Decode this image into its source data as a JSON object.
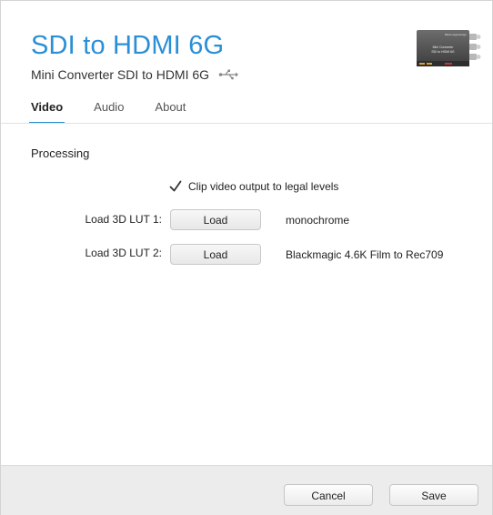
{
  "header": {
    "title": "SDI to HDMI 6G",
    "subtitle": "Mini Converter SDI to HDMI 6G",
    "device_brand": "Blackmagicdesign",
    "device_label_line1": "Mini Converter",
    "device_label_line2": "SDI to HDMI 6G",
    "usb_icon": "usb-icon"
  },
  "tabs": [
    {
      "label": "Video",
      "active": true
    },
    {
      "label": "Audio",
      "active": false
    },
    {
      "label": "About",
      "active": false
    }
  ],
  "processing": {
    "section_title": "Processing",
    "clip_checkbox_label": "Clip video output to legal levels",
    "clip_checked": true,
    "lut1": {
      "label": "Load 3D LUT 1:",
      "button": "Load",
      "value": "monochrome"
    },
    "lut2": {
      "label": "Load 3D LUT 2:",
      "button": "Load",
      "value": "Blackmagic 4.6K Film to Rec709"
    }
  },
  "footer": {
    "cancel_label": "Cancel",
    "save_label": "Save"
  },
  "colors": {
    "accent": "#2a8fd6"
  }
}
